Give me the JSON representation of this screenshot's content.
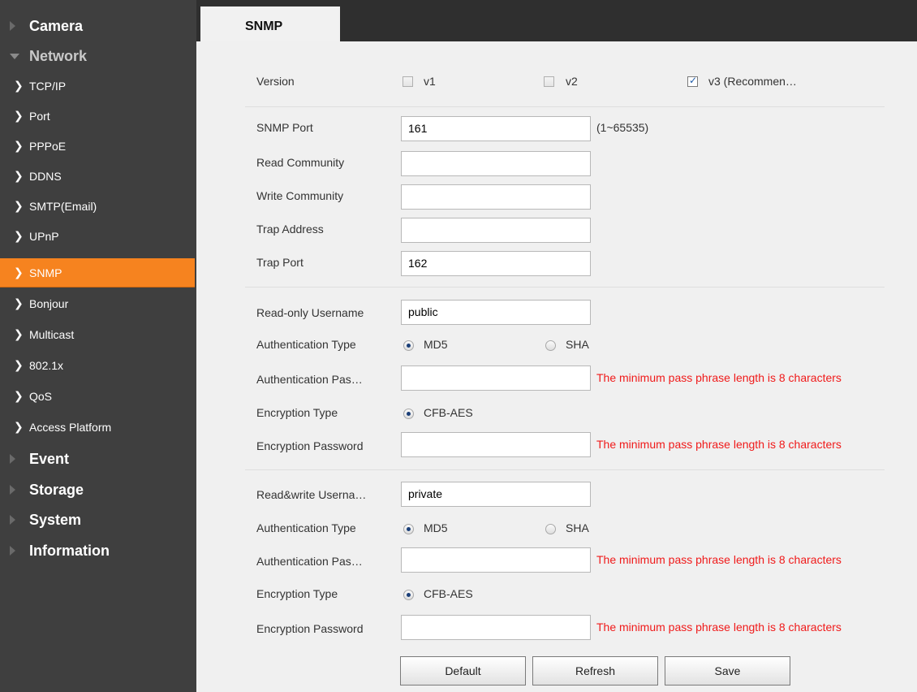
{
  "sidebar": {
    "camera": "Camera",
    "network": "Network",
    "items": [
      {
        "label": "TCP/IP"
      },
      {
        "label": "Port"
      },
      {
        "label": "PPPoE"
      },
      {
        "label": "DDNS"
      },
      {
        "label": "SMTP(Email)"
      },
      {
        "label": "UPnP"
      },
      {
        "label": "SNMP",
        "active": true
      },
      {
        "label": "Bonjour"
      },
      {
        "label": "Multicast"
      },
      {
        "label": "802.1x"
      },
      {
        "label": "QoS"
      },
      {
        "label": "Access Platform"
      }
    ],
    "event": "Event",
    "storage": "Storage",
    "system": "System",
    "information": "Information"
  },
  "header": {
    "tab": "SNMP"
  },
  "form": {
    "version": {
      "label": "Version",
      "v1": {
        "label": "v1",
        "checked": false
      },
      "v2": {
        "label": "v2",
        "checked": false
      },
      "v3": {
        "label": "v3 (Recommen…",
        "checked": true
      }
    },
    "snmp_port": {
      "label": "SNMP Port",
      "value": "161",
      "hint": "(1~65535)"
    },
    "read_community": {
      "label": "Read Community",
      "value": ""
    },
    "write_community": {
      "label": "Write Community",
      "value": ""
    },
    "trap_address": {
      "label": "Trap Address",
      "value": ""
    },
    "trap_port": {
      "label": "Trap Port",
      "value": "162"
    },
    "readonly": {
      "username_label": "Read-only Username",
      "username_value": "public",
      "auth_type_label": "Authentication Type",
      "auth_md5": "MD5",
      "auth_sha": "SHA",
      "auth_selected": "MD5",
      "auth_pass_label": "Authentication Pas…",
      "auth_pass_error": "The minimum pass phrase length is 8 characters",
      "enc_type_label": "Encryption Type",
      "enc_cfb": "CFB-AES",
      "enc_pass_label": "Encryption Password",
      "enc_pass_error": "The minimum pass phrase length is 8 characters"
    },
    "readwrite": {
      "username_label": "Read&write Userna…",
      "username_value": "private",
      "auth_type_label": "Authentication Type",
      "auth_md5": "MD5",
      "auth_sha": "SHA",
      "auth_selected": "MD5",
      "auth_pass_label": "Authentication Pas…",
      "auth_pass_error": "The minimum pass phrase length is 8 characters",
      "enc_type_label": "Encryption Type",
      "enc_cfb": "CFB-AES",
      "enc_pass_label": "Encryption Password",
      "enc_pass_error": "The minimum pass phrase length is 8 characters"
    }
  },
  "buttons": {
    "default": "Default",
    "refresh": "Refresh",
    "save": "Save"
  },
  "colors": {
    "accent": "#f6831f",
    "error": "#f01a1a",
    "sidebar_bg": "#3f3f3f",
    "header_bg": "#2f2f2f"
  }
}
